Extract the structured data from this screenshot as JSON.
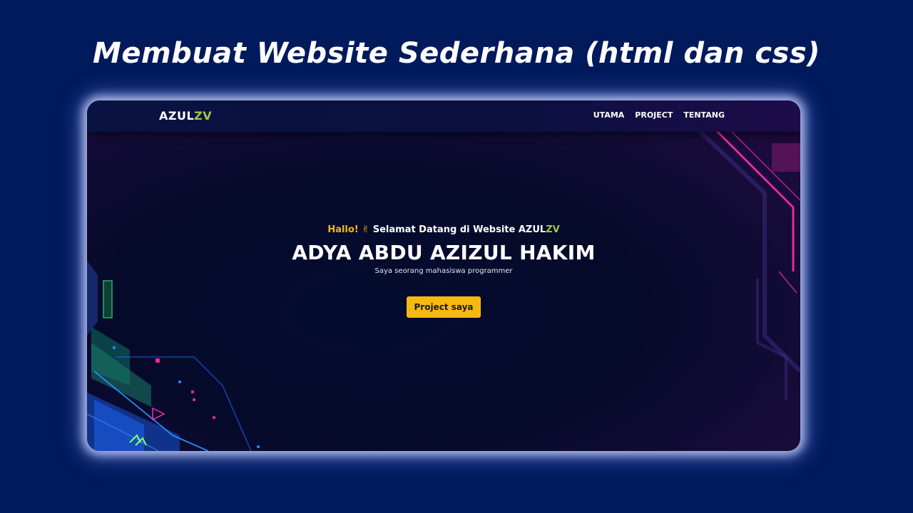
{
  "heading": "Membuat Website Sederhana (html dan css)",
  "navbar": {
    "brand_main": "AZUL",
    "brand_accent": "ZV",
    "links": [
      "UTAMA",
      "PROJECT",
      "TENTANG"
    ]
  },
  "hero": {
    "greeting_hallo": "Hallo!",
    "greeting_emoji": "✌",
    "greeting_text": " Selamat Datang di Website AZUL",
    "greeting_accent": "ZV",
    "name": "ADYA ABDU AZIZUL HAKIM",
    "subtitle": "Saya seorang mahasiswa programmer",
    "cta_label": "Project saya"
  },
  "colors": {
    "page_background": "#001a5c",
    "accent_yellow": "#f5b914",
    "accent_green": "#9ccc3c",
    "neon_pink": "#ff2aa8",
    "neon_blue": "#1e6cff"
  }
}
